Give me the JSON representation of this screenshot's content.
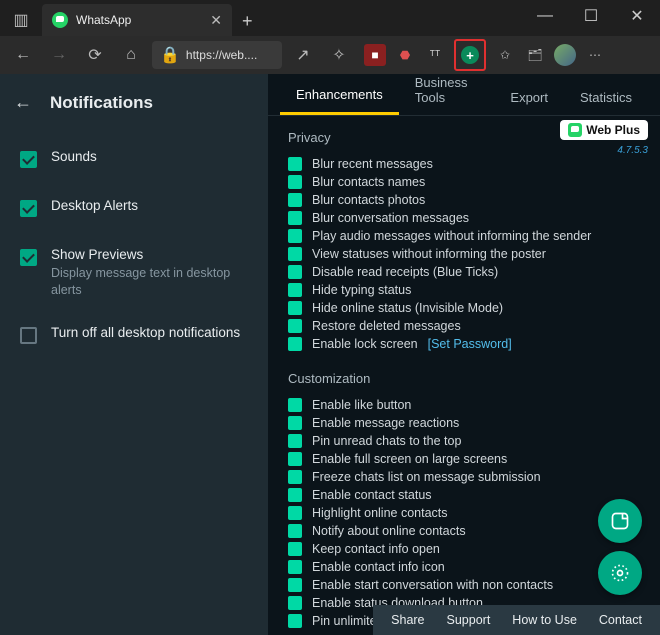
{
  "browser": {
    "tab_title": "WhatsApp",
    "url_display": "https://web....",
    "window": {
      "minimize": "—",
      "maximize": "☐",
      "close": "✕"
    }
  },
  "sidebar": {
    "title": "Notifications",
    "options": [
      {
        "label": "Sounds",
        "checked": true,
        "desc": ""
      },
      {
        "label": "Desktop Alerts",
        "checked": true,
        "desc": ""
      },
      {
        "label": "Show Previews",
        "checked": true,
        "desc": "Display message text in desktop alerts"
      },
      {
        "label": "Turn off all desktop notifications",
        "checked": false,
        "desc": ""
      }
    ]
  },
  "panel": {
    "tabs": [
      "Enhancements",
      "Business Tools",
      "Export",
      "Statistics"
    ],
    "active_tab": 0,
    "brand": {
      "name": "Web Plus",
      "version": "4.7.5.3"
    },
    "sections": [
      {
        "title": "Privacy",
        "items": [
          "Blur recent messages",
          "Blur contacts names",
          "Blur contacts photos",
          "Blur conversation messages",
          "Play audio messages without informing the sender",
          "View statuses without informing the poster",
          "Disable read receipts (Blue Ticks)",
          "Hide typing status",
          "Hide online status (Invisible Mode)",
          "Restore deleted messages",
          "Enable lock screen"
        ],
        "link_after_last": "[Set Password]"
      },
      {
        "title": "Customization",
        "items": [
          "Enable like button",
          "Enable message reactions",
          "Pin unread chats to the top",
          "Enable full screen on large screens",
          "Freeze chats list on message submission",
          "Enable contact status",
          "Highlight online contacts",
          "Notify about online contacts",
          "Keep contact info open",
          "Enable contact info icon",
          "Enable start conversation with non contacts",
          "Enable status download button",
          "Pin unlimited chats (Web Only)"
        ]
      }
    ],
    "footer": [
      "Share",
      "Support",
      "How to Use",
      "Contact"
    ]
  }
}
